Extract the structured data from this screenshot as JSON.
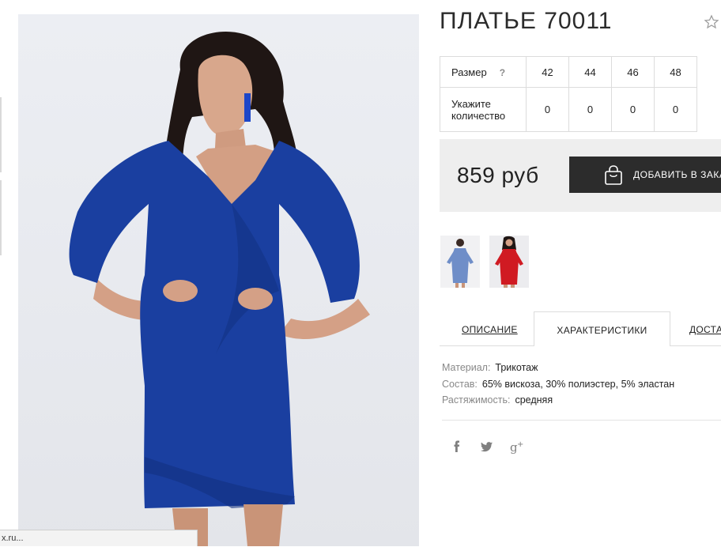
{
  "product": {
    "title": "ПЛАТЬЕ 70011"
  },
  "size_table": {
    "size_label": "Размер",
    "help": "?",
    "sizes": [
      "42",
      "44",
      "46",
      "48"
    ],
    "qty_label_line1": "Укажите",
    "qty_label_line2": "количество",
    "quantities": [
      "0",
      "0",
      "0",
      "0"
    ]
  },
  "buy": {
    "price": "859 руб",
    "add_to_cart_label": "ДОБАВИТЬ В ЗАКАЗ"
  },
  "thumbnails": [
    {
      "color": "blue",
      "hex": "#6f8ec8"
    },
    {
      "color": "red",
      "hex": "#d01a22"
    }
  ],
  "tabs": [
    {
      "label": "ОПИСАНИЕ"
    },
    {
      "label": "ХАРАКТЕРИСТИКИ"
    },
    {
      "label": "ДОСТАВКА"
    }
  ],
  "characteristics": [
    {
      "key": "Материал:",
      "value": "Трикотаж"
    },
    {
      "key": "Состав:",
      "value": "65% вискоза, 30% полиэстер, 5% эластан"
    },
    {
      "key": "Растяжимость:",
      "value": "средняя"
    }
  ],
  "social_icons": [
    "facebook-icon",
    "twitter-icon",
    "google-plus-icon"
  ],
  "status_bar": {
    "url": "x.ru..."
  },
  "colors": {
    "dress": "#1a3fa0",
    "cart_button": "#2c2c2c",
    "buy_box_bg": "#eeeeee"
  }
}
